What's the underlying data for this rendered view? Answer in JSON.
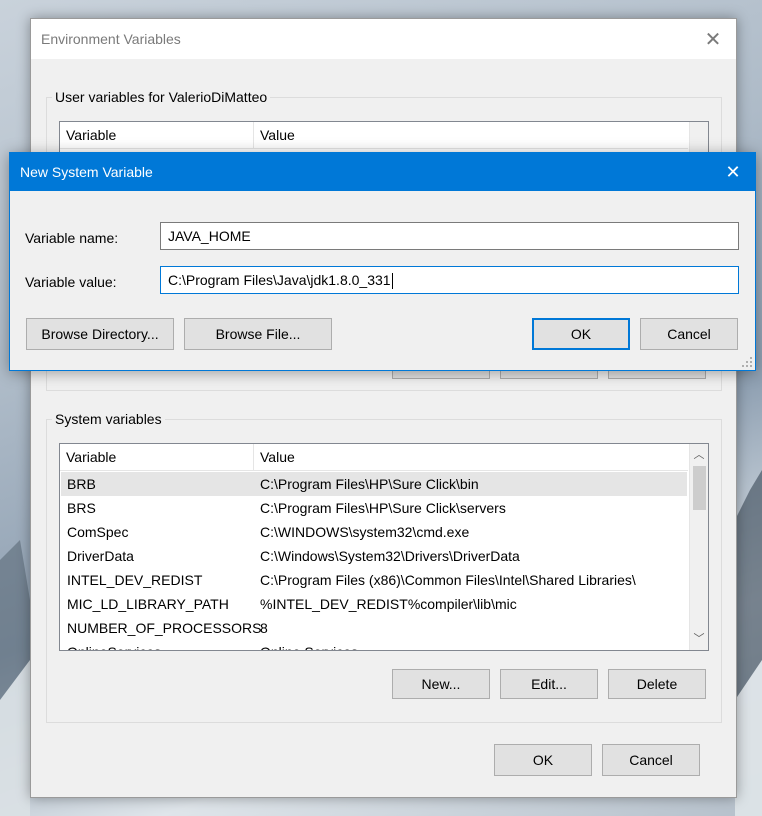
{
  "env_window": {
    "title": "Environment Variables",
    "user_group_label": "User variables for ValerioDiMatteo",
    "user_columns": [
      "Variable",
      "Value"
    ],
    "system_group_label": "System variables",
    "system_columns": [
      "Variable",
      "Value"
    ],
    "system_rows": [
      {
        "variable": "BRB",
        "value": "C:\\Program Files\\HP\\Sure Click\\bin",
        "selected": true
      },
      {
        "variable": "BRS",
        "value": "C:\\Program Files\\HP\\Sure Click\\servers"
      },
      {
        "variable": "ComSpec",
        "value": "C:\\WINDOWS\\system32\\cmd.exe"
      },
      {
        "variable": "DriverData",
        "value": "C:\\Windows\\System32\\Drivers\\DriverData"
      },
      {
        "variable": "INTEL_DEV_REDIST",
        "value": "C:\\Program Files (x86)\\Common Files\\Intel\\Shared Libraries\\"
      },
      {
        "variable": "MIC_LD_LIBRARY_PATH",
        "value": "%INTEL_DEV_REDIST%compiler\\lib\\mic"
      },
      {
        "variable": "NUMBER_OF_PROCESSORS",
        "value": "8"
      },
      {
        "variable": "OnlineServices",
        "value": "Online Services"
      }
    ],
    "system_buttons": {
      "new": "New...",
      "edit": "Edit...",
      "delete": "Delete"
    },
    "footer_buttons": {
      "ok": "OK",
      "cancel": "Cancel"
    }
  },
  "new_var_dialog": {
    "title": "New System Variable",
    "name_label": "Variable name:",
    "name_value": "JAVA_HOME",
    "value_label": "Variable value:",
    "value_value": "C:\\Program Files\\Java\\jdk1.8.0_331",
    "buttons": {
      "browse_dir": "Browse Directory...",
      "browse_file": "Browse File...",
      "ok": "OK",
      "cancel": "Cancel"
    }
  },
  "colors": {
    "accent": "#0078d7",
    "window_bg": "#f0f0f0",
    "button_bg": "#e1e1e1"
  }
}
